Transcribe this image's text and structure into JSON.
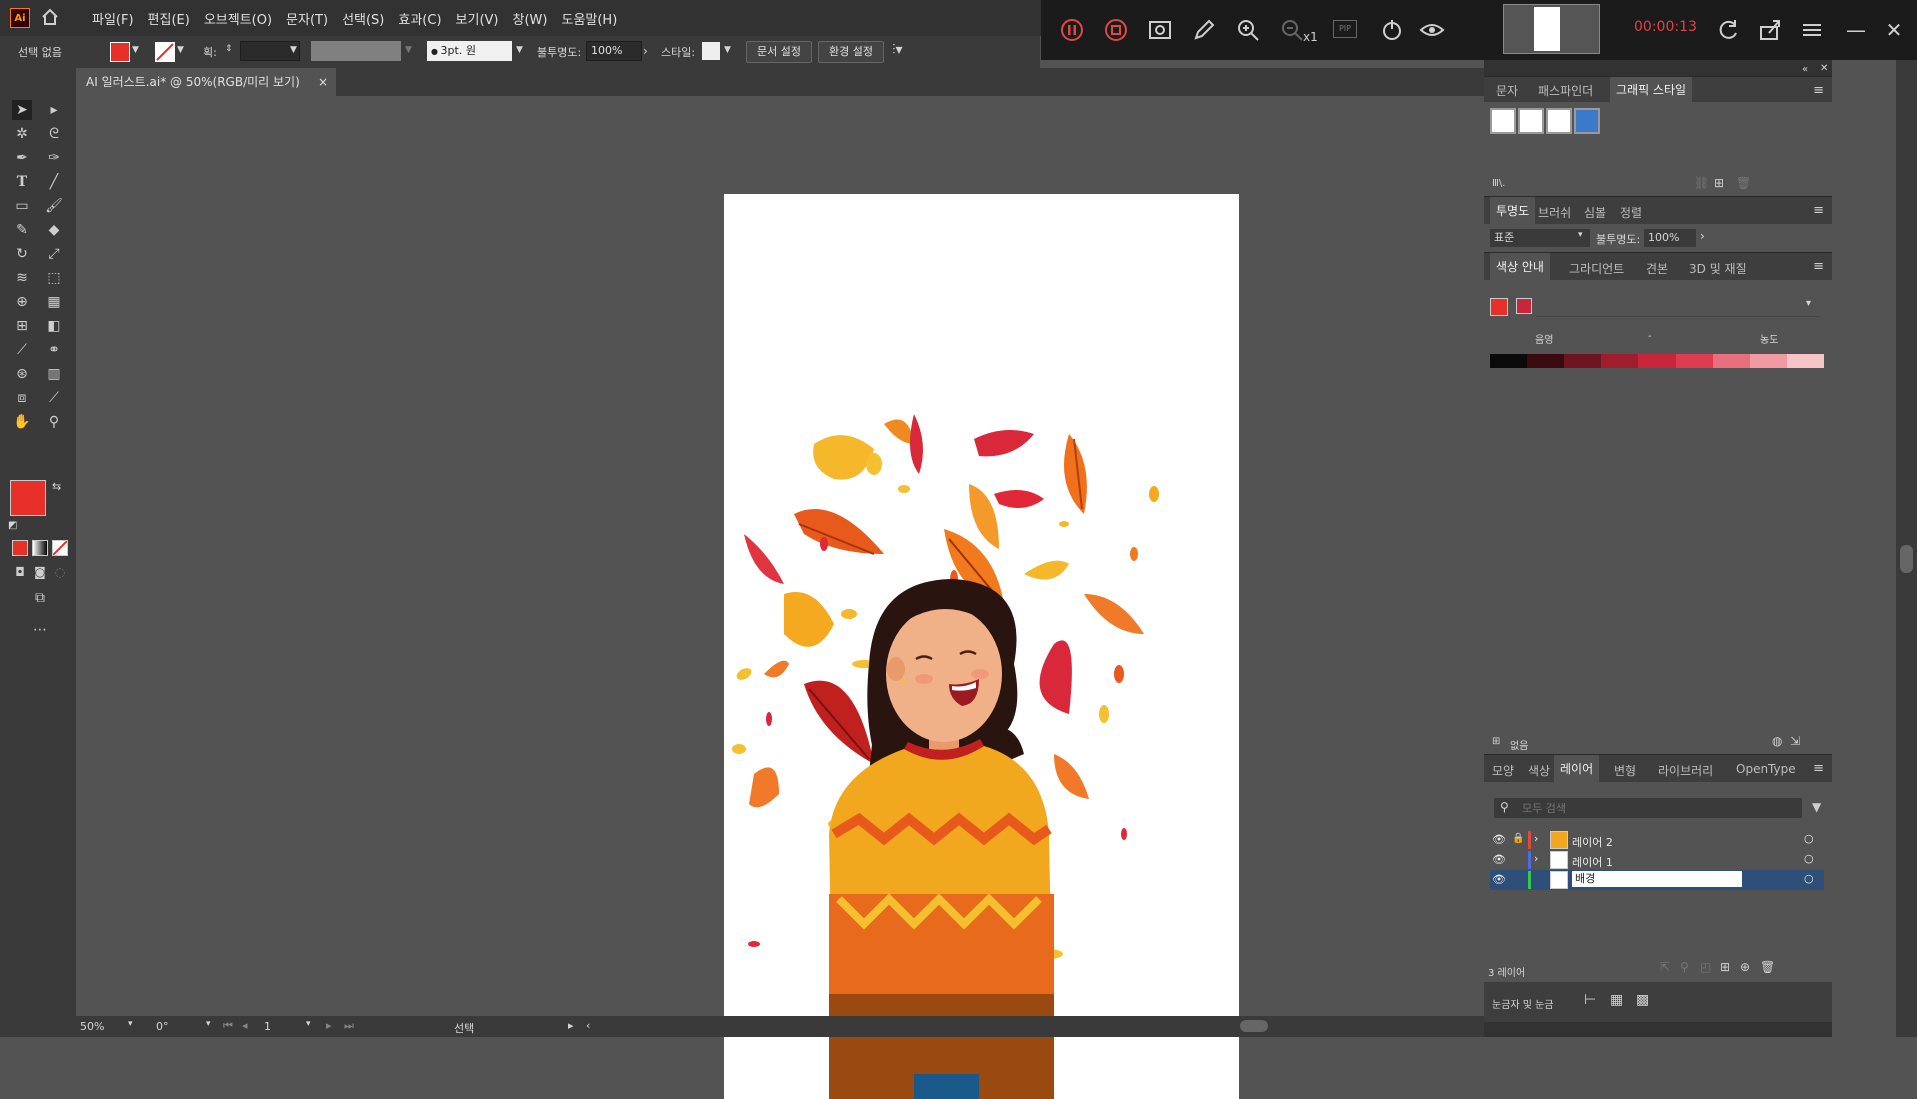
{
  "app": {
    "logo": "Ai",
    "menu": [
      "파일(F)",
      "편집(E)",
      "오브젝트(O)",
      "문자(T)",
      "선택(S)",
      "효과(C)",
      "보기(V)",
      "창(W)",
      "도움말(H)"
    ]
  },
  "recorder": {
    "time": "00:00:13",
    "zoom_label": "x1",
    "pip_label": "PIP"
  },
  "control": {
    "selection_label": "선택 없음",
    "stroke_label": "획:",
    "brush_value": "3pt. 원",
    "opacity_label": "불투명도:",
    "opacity_value": "100%",
    "style_label": "스타일:",
    "doc_setup": "문서 설정",
    "preferences": "환경 설정",
    "fill_color": "#e8302a"
  },
  "document": {
    "tab_title": "AI 일러스트.ai* @ 50%(RGB/미리 보기)",
    "close": "×"
  },
  "status": {
    "zoom": "50%",
    "rotation": "0°",
    "artboard": "1",
    "mode": "선택"
  },
  "panels": {
    "top_tabs": [
      "문자",
      "패스파인더",
      "그래픽 스타일"
    ],
    "graphic_styles_footer": "Ⅲ\\.",
    "transparency_tabs": [
      "투명도",
      "브러쉬",
      "심볼",
      "정렬"
    ],
    "blend_mode": "표준",
    "opacity_label": "불투명도:",
    "opacity_value": "100%",
    "color_guide_tabs": [
      "색상 안내",
      "그라디언트",
      "견본",
      "3D 및 재질"
    ],
    "guide_labels": {
      "left": "음영",
      "middle": "-",
      "right": "농도"
    },
    "guide_colors": [
      "#0a0a0a",
      "#3b0a10",
      "#6e1520",
      "#9e1e2e",
      "#c8263a",
      "#e03c50",
      "#e8707c",
      "#f09aa2",
      "#f7c4c8"
    ],
    "guide_base_colors": [
      "#e8302a",
      "#c8263a"
    ],
    "guide_footer": "없음",
    "layer_tabs": [
      "모양",
      "색상",
      "레이어",
      "변형",
      "라이브러리",
      "OpenType"
    ],
    "search_placeholder": "모두 검색",
    "layers": [
      {
        "name": "레이어 2",
        "color": "#e04a3a",
        "locked": true
      },
      {
        "name": "레이어 1",
        "color": "#4a6ee0",
        "locked": false
      },
      {
        "name": "배경",
        "color": "#3ac84a",
        "locked": false,
        "editing": true
      }
    ],
    "layer_count": "3 레이어",
    "bottom_tab": "눈금자 및 눈금"
  }
}
